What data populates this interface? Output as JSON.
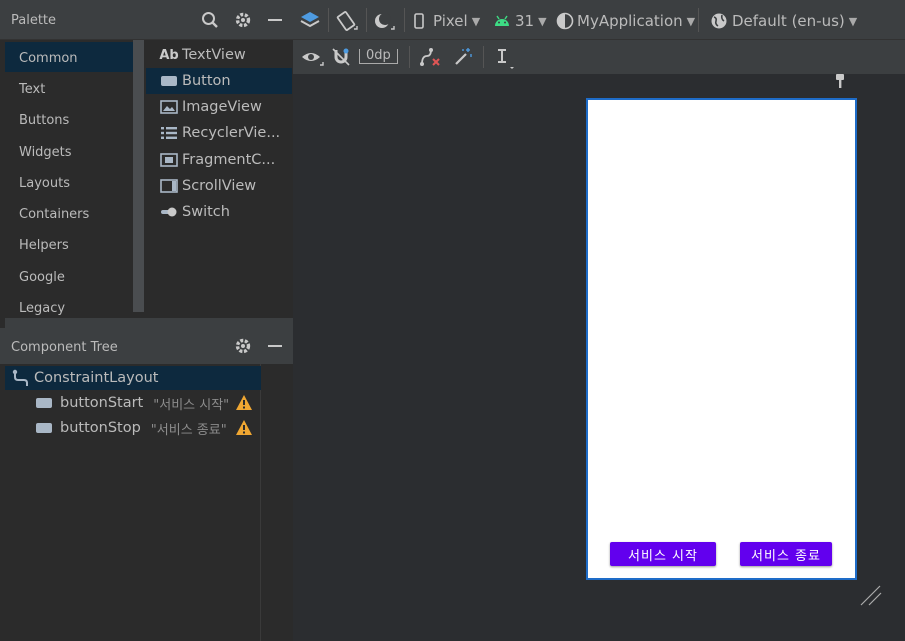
{
  "palette": {
    "title": "Palette",
    "categories": [
      "Common",
      "Text",
      "Buttons",
      "Widgets",
      "Layouts",
      "Containers",
      "Helpers",
      "Google",
      "Legacy"
    ],
    "selected_category": "Common",
    "widgets": [
      {
        "label": "TextView",
        "icon": "text-view-icon"
      },
      {
        "label": "Button",
        "icon": "button-icon"
      },
      {
        "label": "ImageView",
        "icon": "image-view-icon"
      },
      {
        "label": "RecyclerVie...",
        "icon": "recycler-view-icon"
      },
      {
        "label": "FragmentC...",
        "icon": "fragment-container-icon"
      },
      {
        "label": "ScrollView",
        "icon": "scroll-view-icon"
      },
      {
        "label": "Switch",
        "icon": "switch-icon"
      }
    ],
    "selected_widget": "Button",
    "textview_prefix": "Ab"
  },
  "component_tree": {
    "title": "Component Tree",
    "root": "ConstraintLayout",
    "children": [
      {
        "id": "buttonStart",
        "text": "\"서비스 시작\"",
        "warning": true
      },
      {
        "id": "buttonStop",
        "text": "\"서비스 종료\"",
        "warning": true
      }
    ]
  },
  "toolbar": {
    "device": "Pixel",
    "api_level": "31",
    "app_theme": "MyApplication",
    "locale": "Default (en-us)",
    "margin": "0dp"
  },
  "design": {
    "buttons": [
      "서비스 시작",
      "서비스 종료"
    ]
  },
  "colors": {
    "selection": "#0d293e",
    "phone_border": "#1e6cc8",
    "app_button": "#6200ee",
    "android_green": "#3ddc84",
    "warning": "#f0a732"
  }
}
